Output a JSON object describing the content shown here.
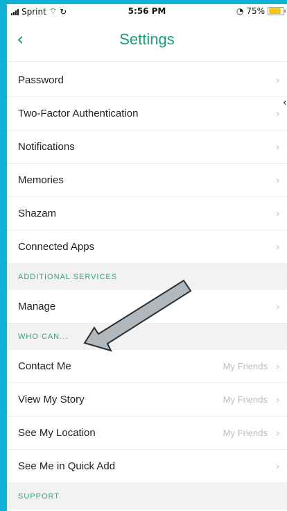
{
  "status_bar": {
    "carrier": "Sprint",
    "time": "5:56 PM",
    "battery": "75%"
  },
  "header": {
    "title": "Settings",
    "back_icon": "chevron-left-icon"
  },
  "rows_top": [
    {
      "label": "Password"
    },
    {
      "label": "Two-Factor Authentication"
    },
    {
      "label": "Notifications"
    },
    {
      "label": "Memories"
    },
    {
      "label": "Shazam"
    },
    {
      "label": "Connected Apps"
    }
  ],
  "section_additional": "ADDITIONAL SERVICES",
  "rows_additional": [
    {
      "label": "Manage"
    }
  ],
  "section_who": "WHO CAN...",
  "rows_who": [
    {
      "label": "Contact Me",
      "value": "My Friends"
    },
    {
      "label": "View My Story",
      "value": "My Friends"
    },
    {
      "label": "See My Location",
      "value": "My Friends"
    },
    {
      "label": "See Me in Quick Add",
      "value": ""
    }
  ],
  "section_support": "SUPPORT",
  "colors": {
    "accent": "#1b9e7a",
    "frame": "#12b2d6",
    "annotation_arrow": "#b0b7bd"
  }
}
